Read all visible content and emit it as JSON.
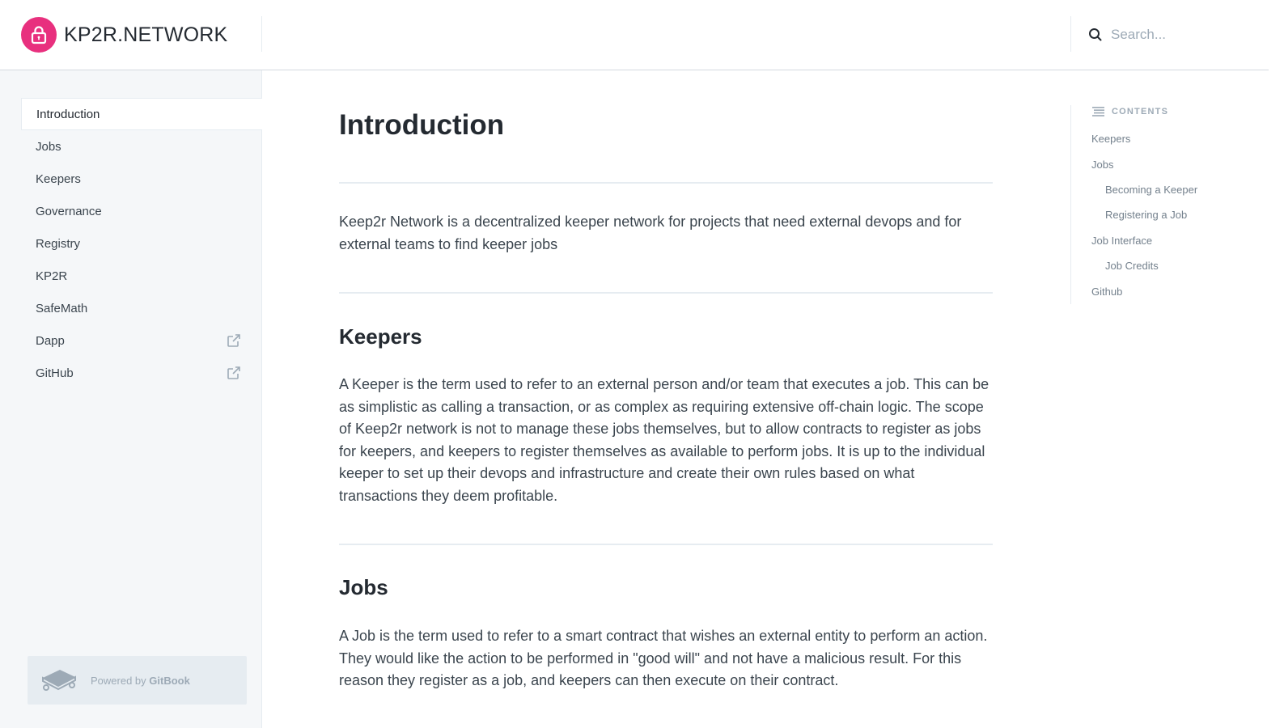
{
  "header": {
    "brand": "KP2R.NETWORK",
    "search_placeholder": "Search...",
    "accent": "#e8307e"
  },
  "sidebar": {
    "items": [
      {
        "label": "Introduction",
        "active": true
      },
      {
        "label": "Jobs"
      },
      {
        "label": "Keepers"
      },
      {
        "label": "Governance"
      },
      {
        "label": "Registry"
      },
      {
        "label": "KP2R"
      },
      {
        "label": "SafeMath"
      },
      {
        "label": "Dapp",
        "icon": "external-link-icon"
      },
      {
        "label": "GitHub",
        "icon": "external-link-icon"
      }
    ],
    "powered_prefix": "Powered by ",
    "powered_brand": "GitBook"
  },
  "main": {
    "title": "Introduction",
    "intro": "Keep2r Network is a decentralized keeper network for projects that need external devops and for external teams to find keeper jobs",
    "sections": [
      {
        "heading": "Keepers",
        "body": "A Keeper is the term used to refer to an external person and/or team that executes a job. This can be as simplistic as calling a transaction, or as complex as requiring extensive off-chain logic. The scope of Keep2r network is not to manage these jobs themselves, but to allow contracts to register as jobs for keepers, and keepers to register themselves as available to perform jobs. It is up to the individual keeper to set up their devops and infrastructure and create their own rules based on what transactions they deem profitable."
      },
      {
        "heading": "Jobs",
        "body": "A Job is the term used to refer to a smart contract that wishes an external entity to perform an action. They would like the action to be performed in \"good will\" and not have a malicious result. For this reason they register as a job, and keepers can then execute on their contract."
      }
    ]
  },
  "toc": {
    "heading": "CONTENTS",
    "items": [
      {
        "label": "Keepers",
        "level": 1
      },
      {
        "label": "Jobs",
        "level": 1
      },
      {
        "label": "Becoming a Keeper",
        "level": 2
      },
      {
        "label": "Registering a Job",
        "level": 2
      },
      {
        "label": "Job Interface",
        "level": 1
      },
      {
        "label": "Job Credits",
        "level": 2
      },
      {
        "label": "Github",
        "level": 1
      }
    ]
  }
}
